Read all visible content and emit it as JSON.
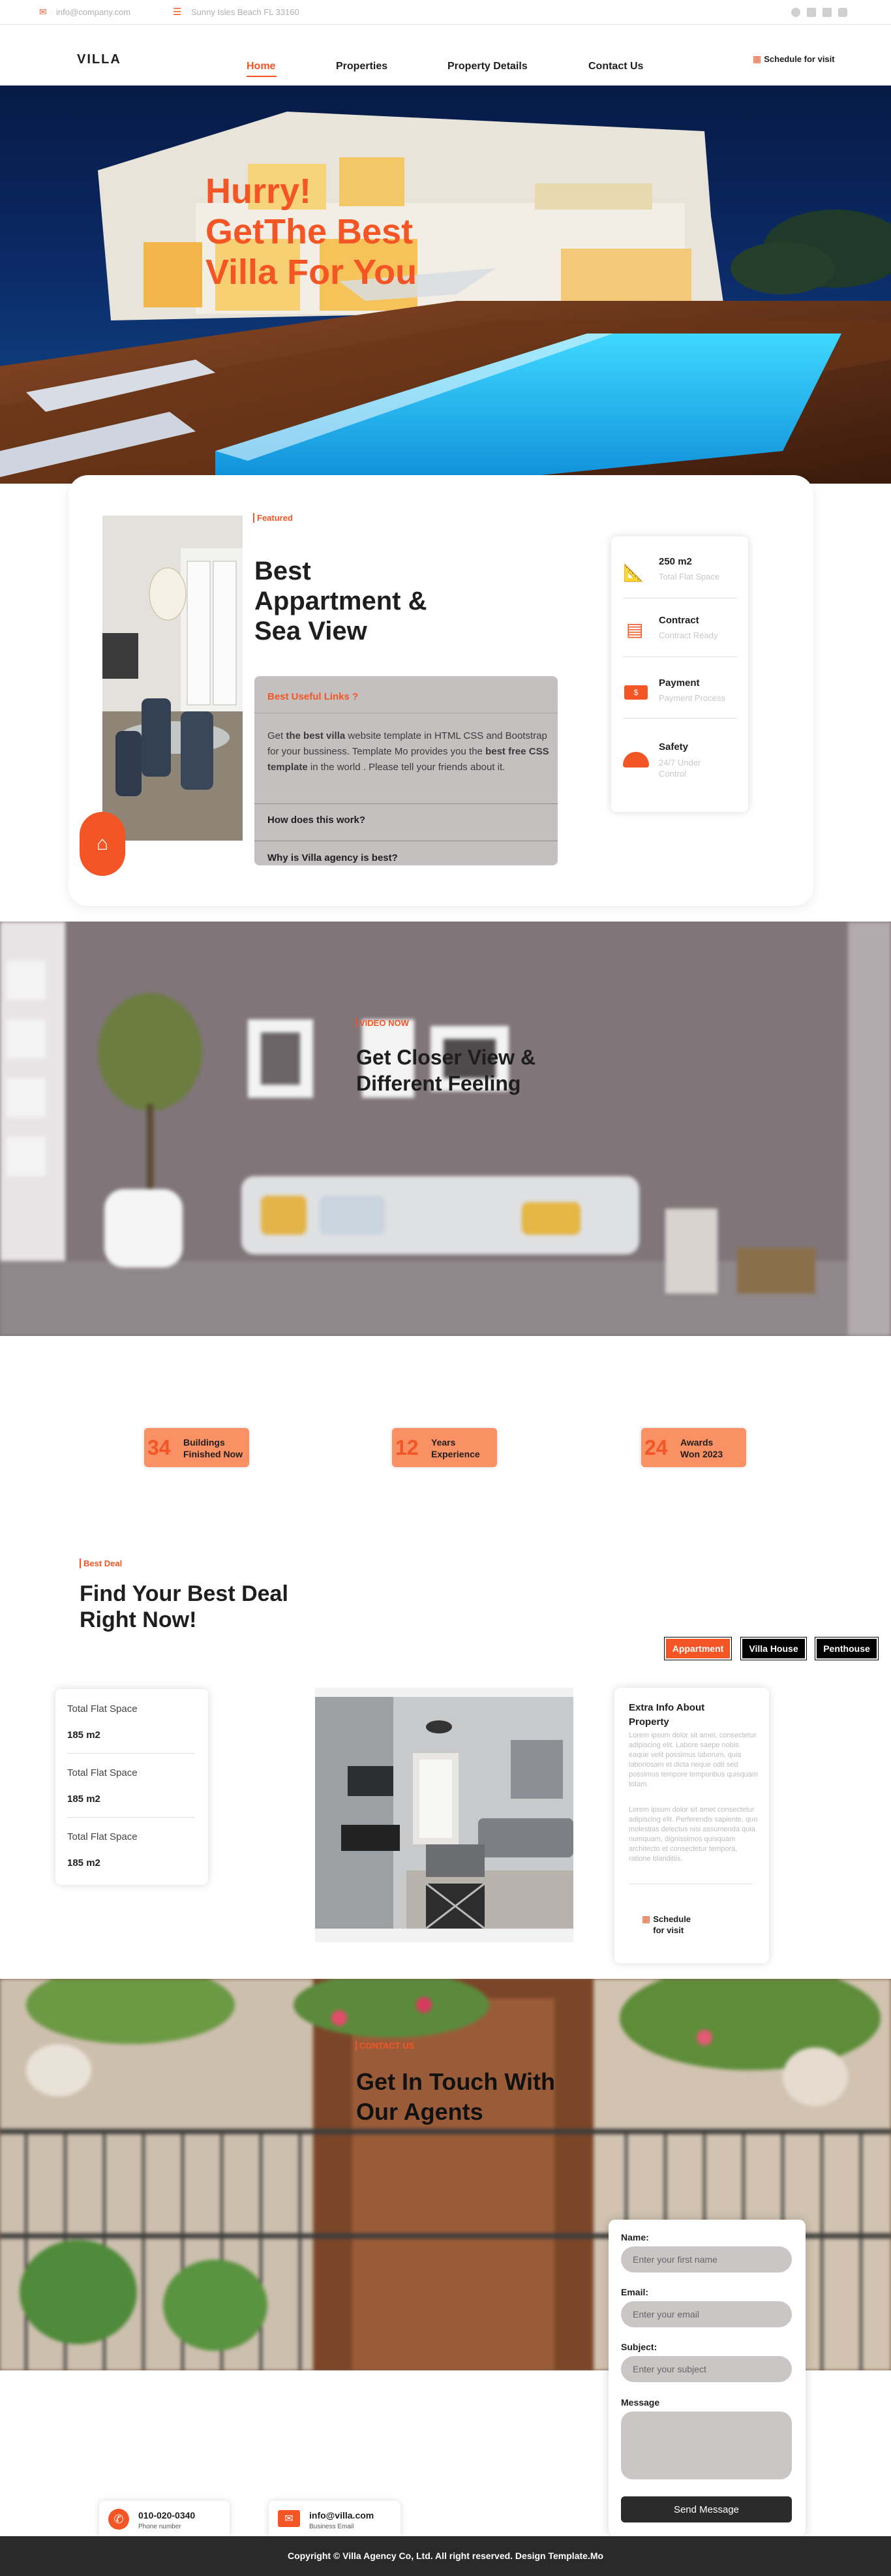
{
  "topbar": {
    "email": "info@company.com",
    "address": "Sunny Isles Beach FL 33160",
    "social_icons": [
      "facebook-icon",
      "twitter-icon",
      "linkedin-icon",
      "instagram-icon"
    ]
  },
  "nav": {
    "logo": "VILLA",
    "items": [
      {
        "label": "Home",
        "active": true
      },
      {
        "label": "Properties",
        "active": false
      },
      {
        "label": "Property Details",
        "active": false
      },
      {
        "label": "Contact Us",
        "active": false
      }
    ],
    "schedule_label": "Schedule for visit"
  },
  "hero": {
    "title_line1": "Hurry!",
    "title_line2": "GetThe Best",
    "title_line3": "Villa For You"
  },
  "featured": {
    "tag": "Featured",
    "title_line1": "Best",
    "title_line2": "Appartment &",
    "title_line3": "Sea View",
    "accordion": {
      "open_title": "Best Useful Links ?",
      "body_part1": "Get ",
      "body_bold1": "the best villa",
      "body_part2": " website template in HTML CSS and Bootstrap for your bussiness. Template Mo provides you the ",
      "body_bold2": "best free CSS template",
      "body_part3": " in the world . Please tell your friends about it.",
      "item2": "How does this work?",
      "item3": "Why is Villa agency is best?"
    },
    "info": [
      {
        "title": "250 m2",
        "sub": "Total Flat Space",
        "icon": "ruler-icon"
      },
      {
        "title": "Contract",
        "sub": "Contract Ready",
        "icon": "document-icon"
      },
      {
        "title": "Payment",
        "sub": "Payment Process",
        "icon": "cash-icon"
      },
      {
        "title": "Safety",
        "sub": "24/7 Under Control",
        "icon": "helmet-icon"
      }
    ]
  },
  "video": {
    "tag": "VIDEO NOW",
    "title_line1": "Get Closer View &",
    "title_line2": "Different Feeling"
  },
  "counters": [
    {
      "num": "34",
      "line1": "Buildings",
      "line2": "Finished Now"
    },
    {
      "num": "12",
      "line1": "Years",
      "line2": "Experience"
    },
    {
      "num": "24",
      "line1": "Awards",
      "line2": "Won 2023"
    }
  ],
  "deal": {
    "tag": "Best Deal",
    "title_line1": "Find Your Best Deal",
    "title_line2": "Right Now!",
    "tabs": [
      {
        "label": "Appartment",
        "active": true
      },
      {
        "label": "Villa House",
        "active": false
      },
      {
        "label": "Penthouse",
        "active": false
      }
    ],
    "specs": [
      {
        "label": "Total Flat Space",
        "value": "185 m2"
      },
      {
        "label": "Total Flat Space",
        "value": "185 m2"
      },
      {
        "label": "Total Flat Space",
        "value": "185 m2"
      }
    ],
    "extra_title": "Extra Info About Property",
    "extra_p1": "Lorem ipsum dolor sit amet, consectetur adipiscing elit. Labore saepe nobis eaque velit possimus laborum, quia laboriosam et dicta neque odit sed possimus tempore temporibus quisquam totam.",
    "extra_p2": "Lorem ipsum dolor sit amet consectetur adipiscing elit. Perferendis sapiente, quo molestias delectus nisi assumenda quia numquam, dignissimos quisquam architecto et consectetur tempora, ratione blanditiis.",
    "schedule_line1": "Schedule",
    "schedule_line2": "for visit"
  },
  "contact": {
    "tag": "CONTACT US",
    "title_line1": "Get In Touch With",
    "title_line2": "Our Agents",
    "form": {
      "name_label": "Name:",
      "name_placeholder": "Enter your first name",
      "email_label": "Email:",
      "email_placeholder": "Enter your email",
      "subject_label": "Subject:",
      "subject_placeholder": "Enter your subject",
      "message_label": "Message",
      "send_label": "Send Message"
    },
    "phone": {
      "value": "010-020-0340",
      "label": "Phone number"
    },
    "email": {
      "value": "info@villa.com",
      "label": "Business Email"
    }
  },
  "footer": {
    "copyright": "Copyright © Villa Agency Co, Ltd. All right reserved. Design Template.Mo"
  },
  "colors": {
    "accent": "#f35525",
    "counter_bg": "#fa9164",
    "accordion_bg": "#c4c0c0",
    "dark": "#1e1e1e",
    "footer_bg": "#2a2a2a"
  }
}
